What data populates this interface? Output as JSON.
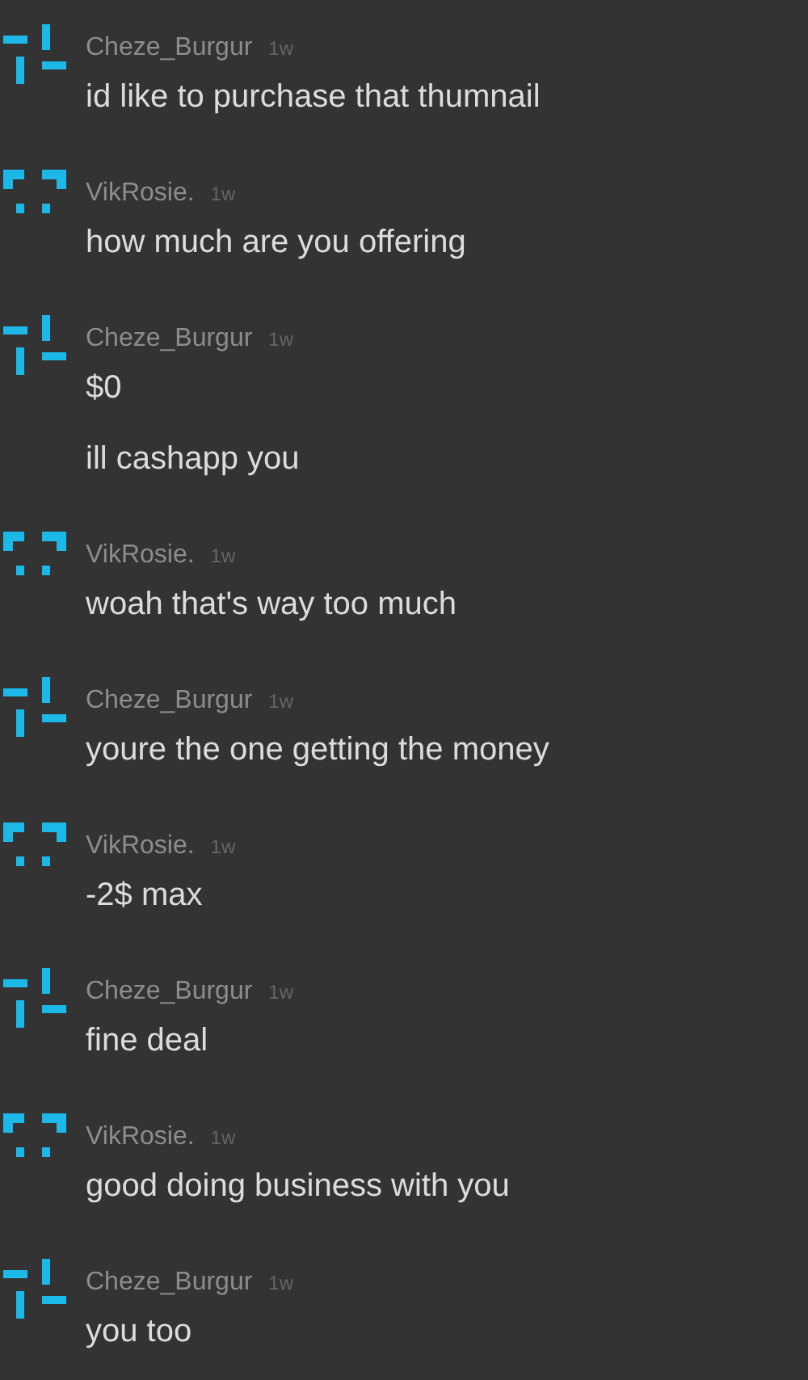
{
  "messages": [
    {
      "author": "Cheze_Burgur",
      "time": "1w",
      "kind": "cross",
      "lines": [
        "id like to purchase that thumnail"
      ]
    },
    {
      "author": "VikRosie.",
      "time": "1w",
      "kind": "brackets",
      "lines": [
        "how much are you offering"
      ]
    },
    {
      "author": "Cheze_Burgur",
      "time": "1w",
      "kind": "cross",
      "lines": [
        "$0",
        "ill cashapp you"
      ]
    },
    {
      "author": "VikRosie.",
      "time": "1w",
      "kind": "brackets",
      "lines": [
        "woah that's way too much"
      ]
    },
    {
      "author": "Cheze_Burgur",
      "time": "1w",
      "kind": "cross",
      "lines": [
        "youre the one getting the money"
      ]
    },
    {
      "author": "VikRosie.",
      "time": "1w",
      "kind": "brackets",
      "lines": [
        "-2$ max"
      ]
    },
    {
      "author": "Cheze_Burgur",
      "time": "1w",
      "kind": "cross",
      "lines": [
        "fine deal"
      ]
    },
    {
      "author": "VikRosie.",
      "time": "1w",
      "kind": "brackets",
      "lines": [
        "good doing business with you"
      ]
    },
    {
      "author": "Cheze_Burgur",
      "time": "1w",
      "kind": "cross",
      "lines": [
        "you too"
      ]
    }
  ]
}
